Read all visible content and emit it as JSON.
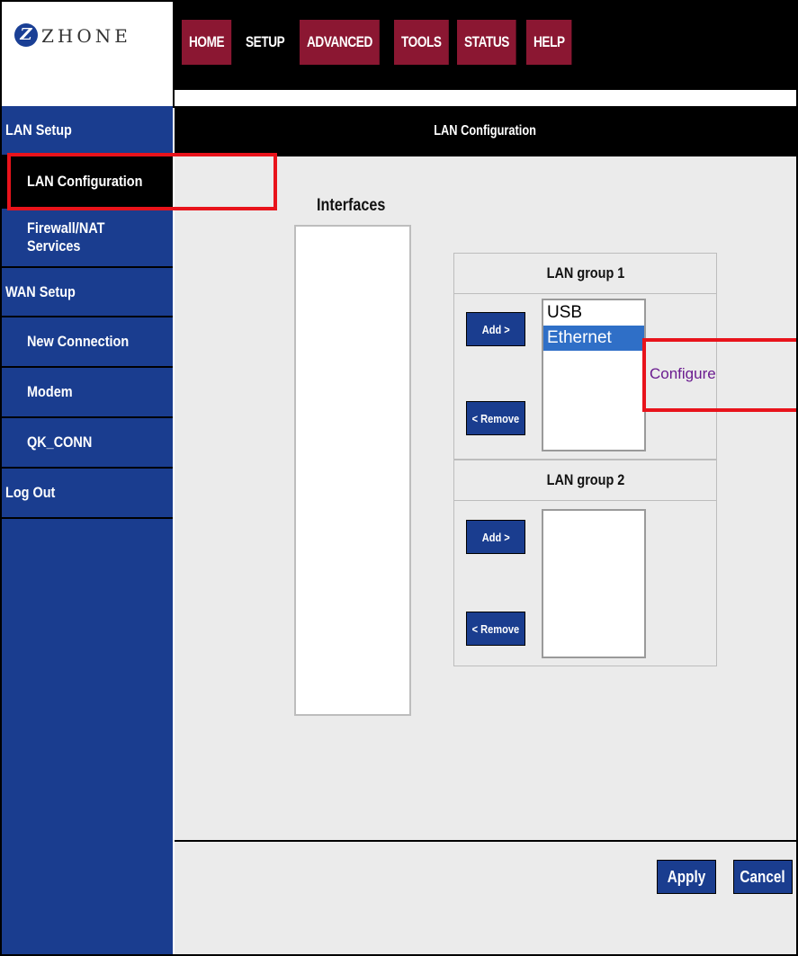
{
  "logo": {
    "mark": "Z",
    "text": "ZHONE"
  },
  "nav_tabs": [
    {
      "label": "HOME",
      "active": false
    },
    {
      "label": "SETUP",
      "active": true
    },
    {
      "label": "ADVANCED",
      "active": false
    },
    {
      "label": "TOOLS",
      "active": false
    },
    {
      "label": "STATUS",
      "active": false
    },
    {
      "label": "HELP",
      "active": false
    }
  ],
  "sidebar": {
    "items": [
      {
        "label": "LAN Setup"
      },
      {
        "label": "LAN Configuration",
        "active": true
      },
      {
        "label": "Firewall/NAT Services"
      },
      {
        "label": "WAN Setup"
      },
      {
        "label": "New Connection"
      },
      {
        "label": "Modem"
      },
      {
        "label": "QK_CONN"
      },
      {
        "label": "Log Out"
      }
    ]
  },
  "page": {
    "title": "LAN Configuration",
    "interfaces_label": "Interfaces",
    "interfaces": []
  },
  "groups": [
    {
      "title": "LAN group 1",
      "add_label": "Add >",
      "remove_label": "< Remove",
      "members": [
        {
          "label": "USB",
          "selected": false
        },
        {
          "label": "Ethernet",
          "selected": true
        }
      ],
      "configure_label": "Configure"
    },
    {
      "title": "LAN group 2",
      "add_label": "Add >",
      "remove_label": "< Remove",
      "members": []
    }
  ],
  "footer": {
    "apply_label": "Apply",
    "cancel_label": "Cancel"
  },
  "colors": {
    "accent_blue": "#1a3d8f",
    "tab_red": "#8b1732",
    "highlight_red": "#e8131b",
    "selection_blue": "#2f6fc7"
  }
}
